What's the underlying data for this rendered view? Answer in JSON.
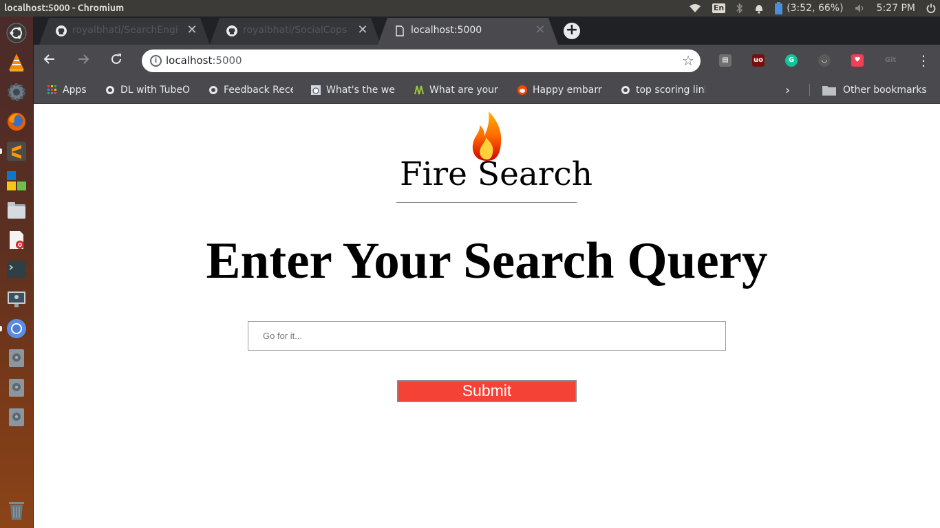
{
  "system": {
    "window_title": "localhost:5000 - Chromium",
    "lang": "En",
    "battery": "(3:52, 66%)",
    "clock": "5:27 PM"
  },
  "launcher": {
    "items": [
      "ubuntu-dash-icon",
      "vlc-icon",
      "settings-icon",
      "firefox-icon",
      "sublime-text-icon",
      "software-center-icon",
      "files-icon",
      "document-viewer-icon",
      "terminal-icon",
      "remote-desktop-icon",
      "chromium-icon",
      "disk-icon",
      "disk-icon",
      "disk-icon",
      "trash-icon"
    ]
  },
  "browser": {
    "tabs": [
      {
        "title": "royalbhati/SearchEngi",
        "active": false
      },
      {
        "title": "royalbhati/SocialCops",
        "active": false
      },
      {
        "title": "localhost:5000",
        "active": true
      }
    ],
    "url_host": "localhost",
    "url_port": ":5000",
    "bookmarks": [
      {
        "label": "Apps"
      },
      {
        "label": "DL with TubeO"
      },
      {
        "label": "Feedback Rece"
      },
      {
        "label": "What's the wei"
      },
      {
        "label": "What are your"
      },
      {
        "label": "Happy embarra"
      },
      {
        "label": "top scoring link"
      }
    ],
    "other_bookmarks": "Other bookmarks"
  },
  "page": {
    "brand": "Fire Search",
    "headline": "Enter Your Search Query",
    "search_placeholder": "Go for it...",
    "submit_label": "Submit",
    "accent_color": "#f44336"
  }
}
